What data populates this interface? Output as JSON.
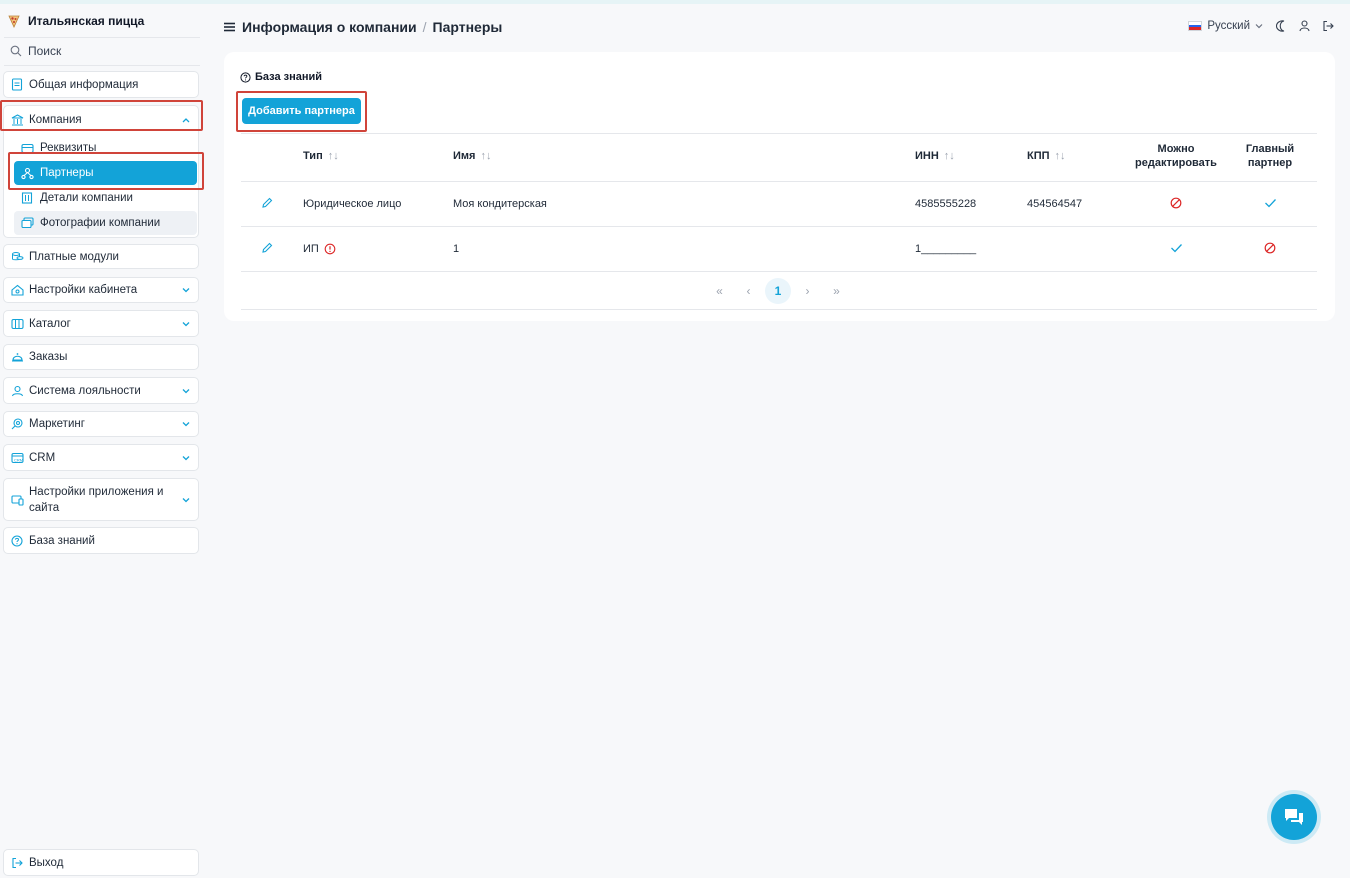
{
  "brand": {
    "name": "Итальянская пицца"
  },
  "sidebar": {
    "search_label": "Поиск",
    "items": [
      {
        "label": "Общая информация",
        "icon": "document-icon"
      },
      {
        "label": "Компания",
        "icon": "bank-icon",
        "expanded": true,
        "children": [
          {
            "label": "Реквизиты",
            "icon": "wallet-icon"
          },
          {
            "label": "Партнеры",
            "icon": "partners-icon",
            "active": true
          },
          {
            "label": "Детали компании",
            "icon": "building-icon"
          },
          {
            "label": "Фотографии компании",
            "icon": "photos-icon"
          }
        ]
      },
      {
        "label": "Платные модули",
        "icon": "coins-icon"
      },
      {
        "label": "Настройки кабинета",
        "icon": "cabinet-settings-icon"
      },
      {
        "label": "Каталог",
        "icon": "catalog-icon"
      },
      {
        "label": "Заказы",
        "icon": "cloche-icon"
      },
      {
        "label": "Система лояльности",
        "icon": "loyalty-icon"
      },
      {
        "label": "Маркетинг",
        "icon": "marketing-icon"
      },
      {
        "label": "CRM",
        "icon": "crm-icon"
      },
      {
        "label": "Настройки приложения и сайта",
        "icon": "devices-icon"
      },
      {
        "label": "База знаний",
        "icon": "help-icon"
      }
    ],
    "logout_label": "Выход"
  },
  "header": {
    "crumb1": "Информация о компании",
    "separator": "/",
    "crumb2": "Партнеры",
    "language": "Русский"
  },
  "main": {
    "kb_link": "База знаний",
    "add_button": "Добавить партнера",
    "columns": {
      "type": "Тип",
      "name": "Имя",
      "inn": "ИНН",
      "kpp": "КПП",
      "editable_line1": "Можно",
      "editable_line2": "редактировать",
      "main_line1": "Главный",
      "main_line2": "партнер"
    },
    "sort_glyph": "↑↓",
    "rows": [
      {
        "type": "Юридическое лицо",
        "name": "Моя кондитерская",
        "inn": "4585555228",
        "kpp": "454564547",
        "editable": false,
        "main_partner": true
      },
      {
        "type": "ИП",
        "type_warning": true,
        "name": "1",
        "inn": "1_________",
        "kpp": "",
        "editable": true,
        "main_partner": false
      }
    ],
    "pagination": {
      "first": "«",
      "prev": "‹",
      "current": "1",
      "next": "›",
      "last": "»"
    }
  },
  "colors": {
    "accent": "#13a3d8",
    "danger": "#d0443a",
    "highlight_box": "#d0443a"
  }
}
